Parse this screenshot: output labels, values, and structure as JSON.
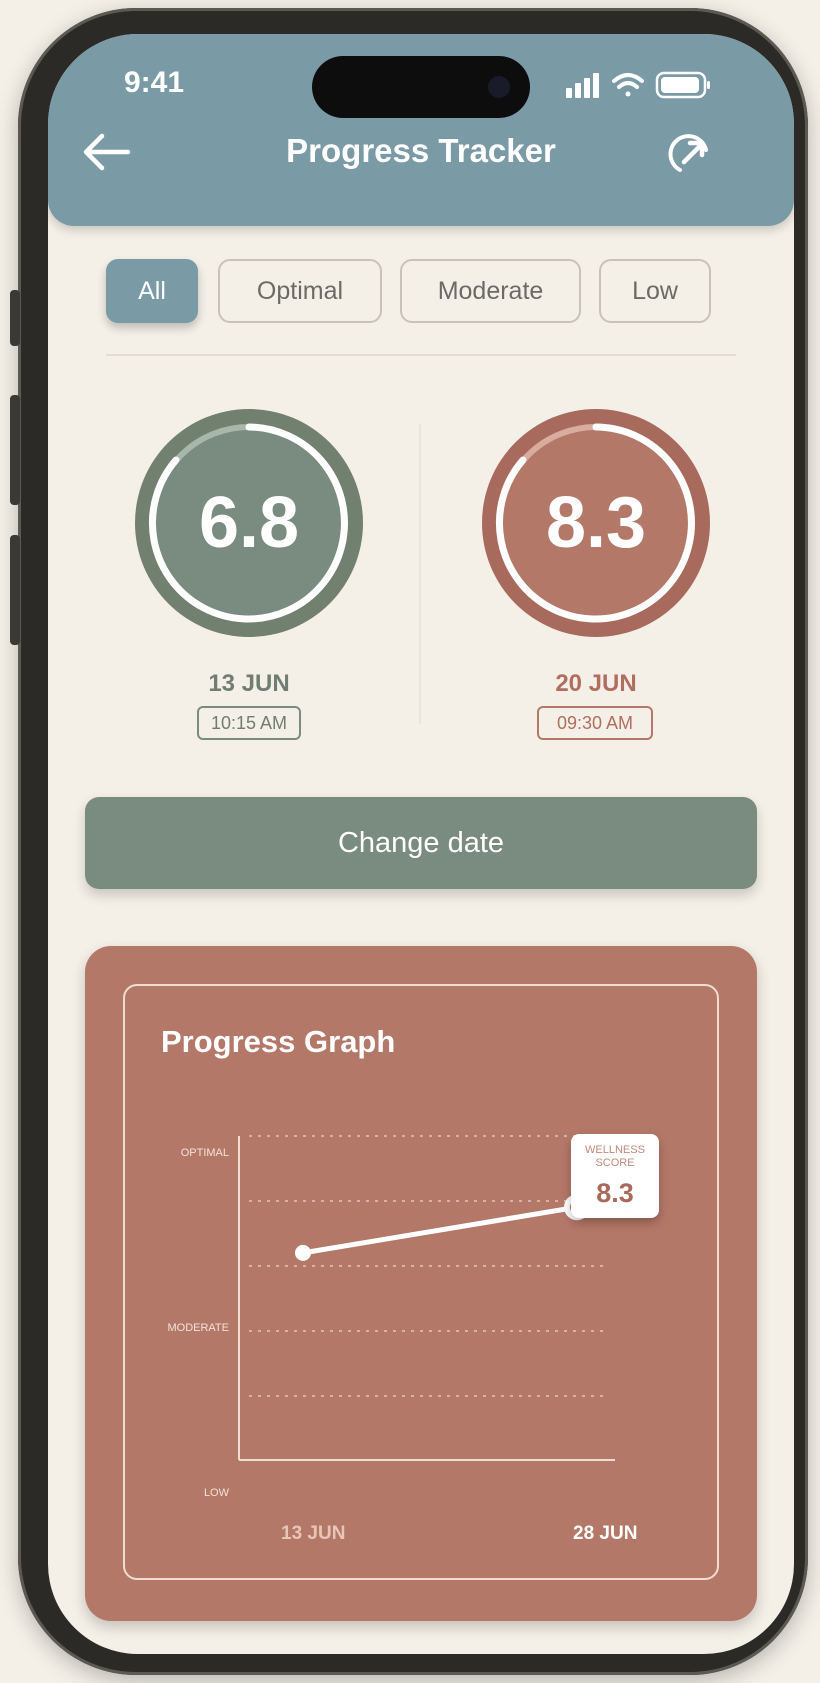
{
  "status_bar": {
    "time": "9:41"
  },
  "header": {
    "title": "Progress Tracker"
  },
  "filters": {
    "tabs": [
      {
        "label": "All",
        "active": true
      },
      {
        "label": "Optimal",
        "active": false
      },
      {
        "label": "Moderate",
        "active": false
      },
      {
        "label": "Low",
        "active": false
      }
    ]
  },
  "comparison": {
    "left": {
      "score": "6.8",
      "date": "13 JUN",
      "time": "10:15 AM",
      "color": "#7a8c80"
    },
    "right": {
      "score": "8.3",
      "date": "20 JUN",
      "time": "09:30 AM",
      "color": "#b47868"
    }
  },
  "change_date_label": "Change date",
  "graph": {
    "title": "Progress Graph",
    "tooltip": {
      "label": "WELLNESS SCORE",
      "value": "8.3"
    }
  },
  "chart_data": {
    "type": "line",
    "title": "Progress Graph",
    "y_tick_labels": [
      "OPTIMAL",
      "MODERATE",
      "LOW"
    ],
    "x_tick_labels": [
      "13 JUN",
      "28 JUN"
    ],
    "x": [
      "13 JUN",
      "28 JUN"
    ],
    "values": [
      6.8,
      8.3
    ],
    "ylim": [
      0,
      10
    ],
    "grid": true,
    "highlight": {
      "x": "28 JUN",
      "label": "WELLNESS SCORE",
      "value": 8.3
    }
  }
}
